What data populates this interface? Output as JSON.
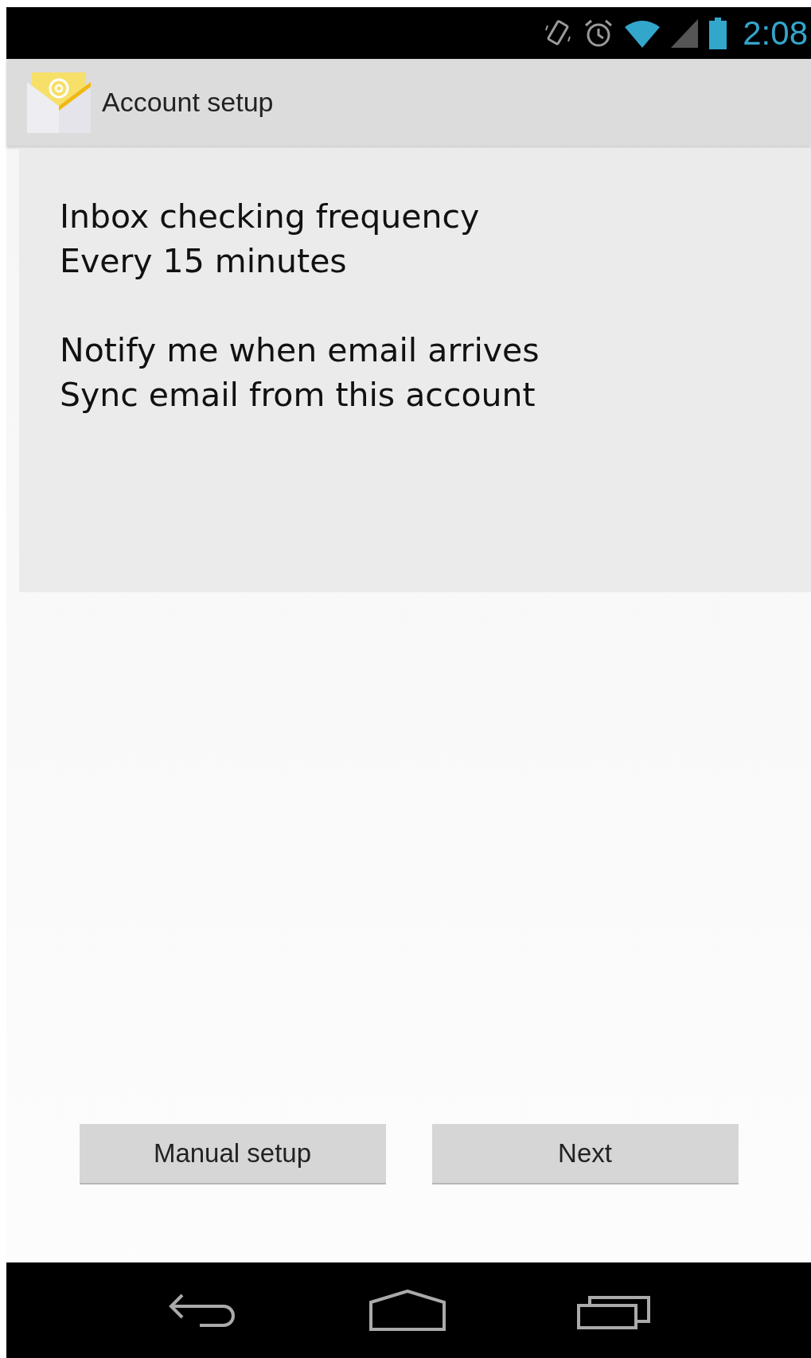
{
  "status_bar": {
    "time": "2:08"
  },
  "action_bar": {
    "title": "Account setup"
  },
  "settings": [
    {
      "lines": [
        "Inbox checking frequency",
        "Every 15 minutes"
      ]
    },
    {
      "lines": [
        "Notify me when email arrives",
        "Sync email from this account"
      ]
    }
  ],
  "buttons": [
    "Manual setup",
    "Next"
  ]
}
